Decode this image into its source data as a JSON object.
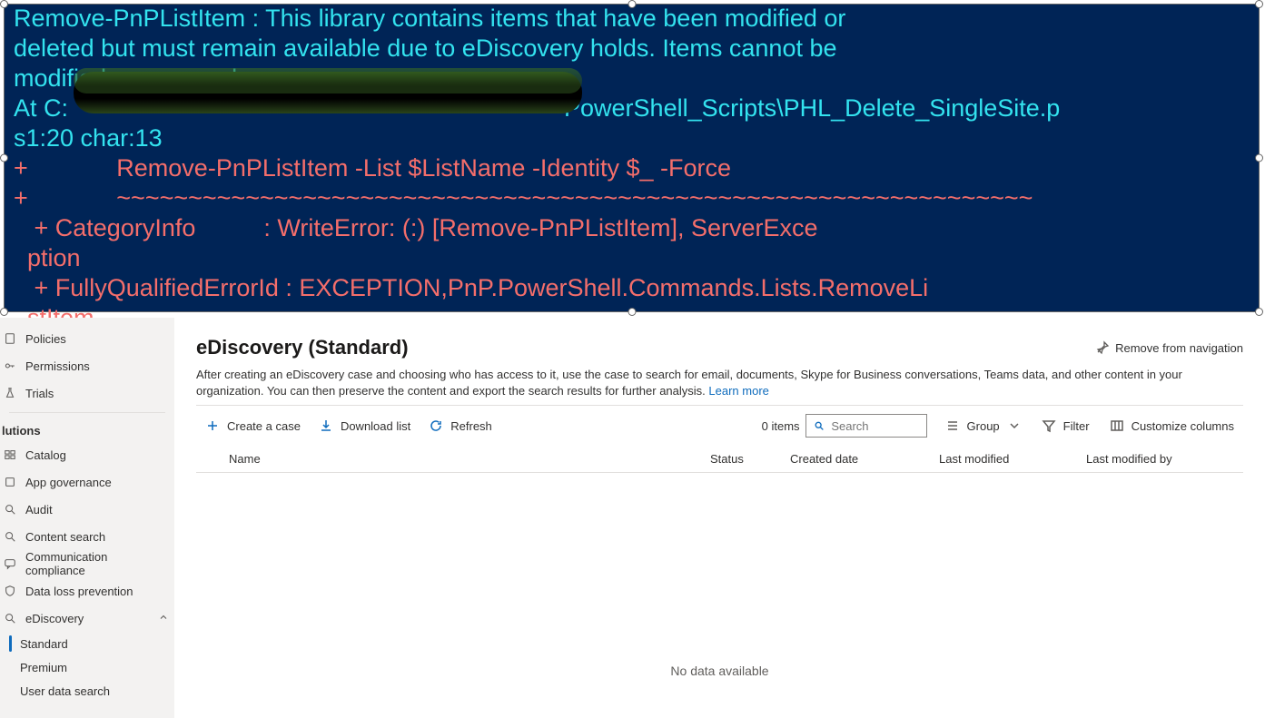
{
  "console": {
    "line1_pre": "Remove-PnPListItem : This library contains items that have been modified or",
    "line2": "deleted but must remain available due to eDiscovery holds. Items cannot be",
    "line3": "modified or removed.",
    "line4_left": "At C:",
    "line4_right": "PowerShell_Scripts\\PHL_Delete_SingleSite.p",
    "line5": "s1:20 char:13",
    "line6": "+             Remove-PnPListItem -List $ListName -Identity $_ -Force",
    "line7": "+             ~~~~~~~~~~~~~~~~~~~~~~~~~~~~~~~~~~~~~~~~~~~~~~~~~~~~~~~~~~~~~~~~",
    "line8": "   + CategoryInfo          : WriteError: (:) [Remove-PnPListItem], ServerExce",
    "line9": "  ption",
    "line10": "   + FullyQualifiedErrorId : EXCEPTION,PnP.PowerShell.Commands.Lists.RemoveLi",
    "line11": "  stItem"
  },
  "sidebar": {
    "items_top": [
      {
        "label": "Policies"
      },
      {
        "label": "Permissions"
      },
      {
        "label": "Trials"
      }
    ],
    "header": "lutions",
    "items_sol": [
      {
        "label": "Catalog"
      },
      {
        "label": "App governance"
      },
      {
        "label": "Audit"
      },
      {
        "label": "Content search"
      },
      {
        "label": "Communication compliance"
      },
      {
        "label": "Data loss prevention"
      },
      {
        "label": "eDiscovery"
      }
    ],
    "sub_items": [
      {
        "label": "Standard",
        "active": true
      },
      {
        "label": "Premium",
        "active": false
      },
      {
        "label": "User data search",
        "active": false
      }
    ]
  },
  "page": {
    "title": "eDiscovery (Standard)",
    "remove_nav": "Remove from navigation",
    "desc": "After creating an eDiscovery case and choosing who has access to it, use the case to search for email, documents, Skype for Business conversations, Teams data, and other content in your organization. You can then preserve the content and export the search results for further analysis. ",
    "learn_more": "Learn more"
  },
  "cmdbar": {
    "create": "Create a case",
    "download": "Download list",
    "refresh": "Refresh",
    "count": "0 items",
    "search_placeholder": "Search",
    "group": "Group",
    "filter": "Filter",
    "customize": "Customize columns"
  },
  "table": {
    "cols": {
      "name": "Name",
      "status": "Status",
      "created": "Created date",
      "modified": "Last modified",
      "by": "Last modified by"
    },
    "empty": "No data available"
  }
}
